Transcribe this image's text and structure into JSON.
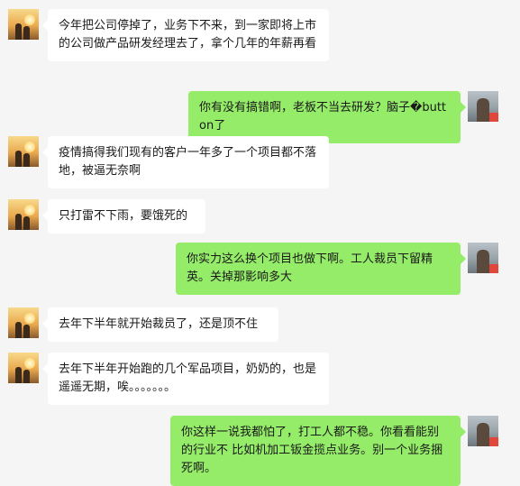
{
  "colors": {
    "background": "#f5f5f5",
    "incoming_bubble": "#ffffff",
    "outgoing_bubble": "#95ec69"
  },
  "messages": [
    {
      "side": "left",
      "avatar": "sunset-couple-avatar",
      "text": "今年把公司停掉了，业务下不来，到一家即将上市的公司做产品研发经理去了，拿个几年的年薪再看"
    },
    {
      "side": "right",
      "avatar": "user-photo-avatar",
      "text": "你有没有搞错啊，老板不当去研发？脑子�button了"
    },
    {
      "side": "left",
      "avatar": "sunset-couple-avatar",
      "text": "疫情搞得我们现有的客户一年多了一个项目都不落地，被逼无奈啊"
    },
    {
      "side": "left",
      "avatar": "sunset-couple-avatar",
      "text": "只打雷不下雨，要饿死的"
    },
    {
      "side": "right",
      "avatar": "user-photo-avatar",
      "text": "你实力这么换个项目也做下啊。工人裁员下留精英。关掉那影响多大"
    },
    {
      "side": "left",
      "avatar": "sunset-couple-avatar",
      "text": "去年下半年就开始裁员了，还是顶不住"
    },
    {
      "side": "left",
      "avatar": "sunset-couple-avatar",
      "text": "去年下半年开始跑的几个军品项目，奶奶的，也是遥遥无期，唉。。。。。。。"
    },
    {
      "side": "right",
      "avatar": "user-photo-avatar",
      "text": "你这样一说我都怕了，打工人都不稳。你看看能别的行业不 比如机加工钣金揽点业务。别一个业务捆死啊。"
    }
  ]
}
